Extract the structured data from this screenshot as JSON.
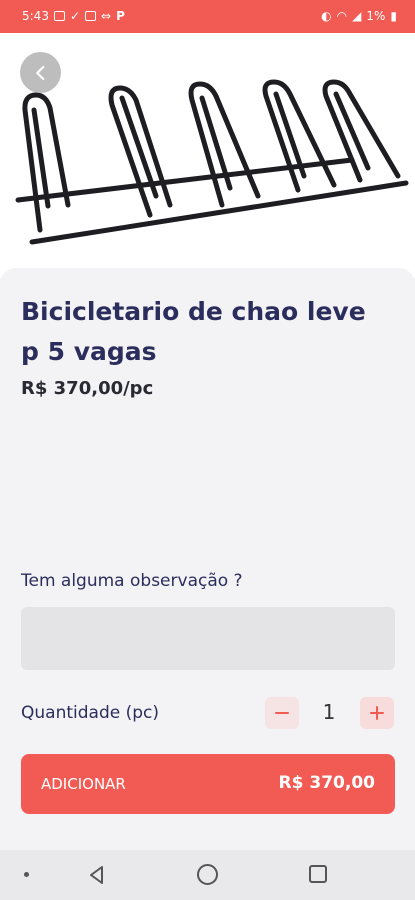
{
  "status_bar": {
    "time": "5:43",
    "battery": "1%"
  },
  "product": {
    "title": "Bicicletario de chao leve p 5 vagas",
    "price": "R$ 370,00/pc",
    "image_icon": "bike-rack-image"
  },
  "observation": {
    "label": "Tem alguma observação ?",
    "value": ""
  },
  "quantity": {
    "label": "Quantidade (pc)",
    "value": "1",
    "minus_symbol": "−",
    "plus_symbol": "+"
  },
  "add_button": {
    "label": "ADICIONAR",
    "total": "R$ 370,00"
  },
  "colors": {
    "accent": "#f25b54",
    "title": "#2b2d5c",
    "background": "#f3f3f5"
  }
}
